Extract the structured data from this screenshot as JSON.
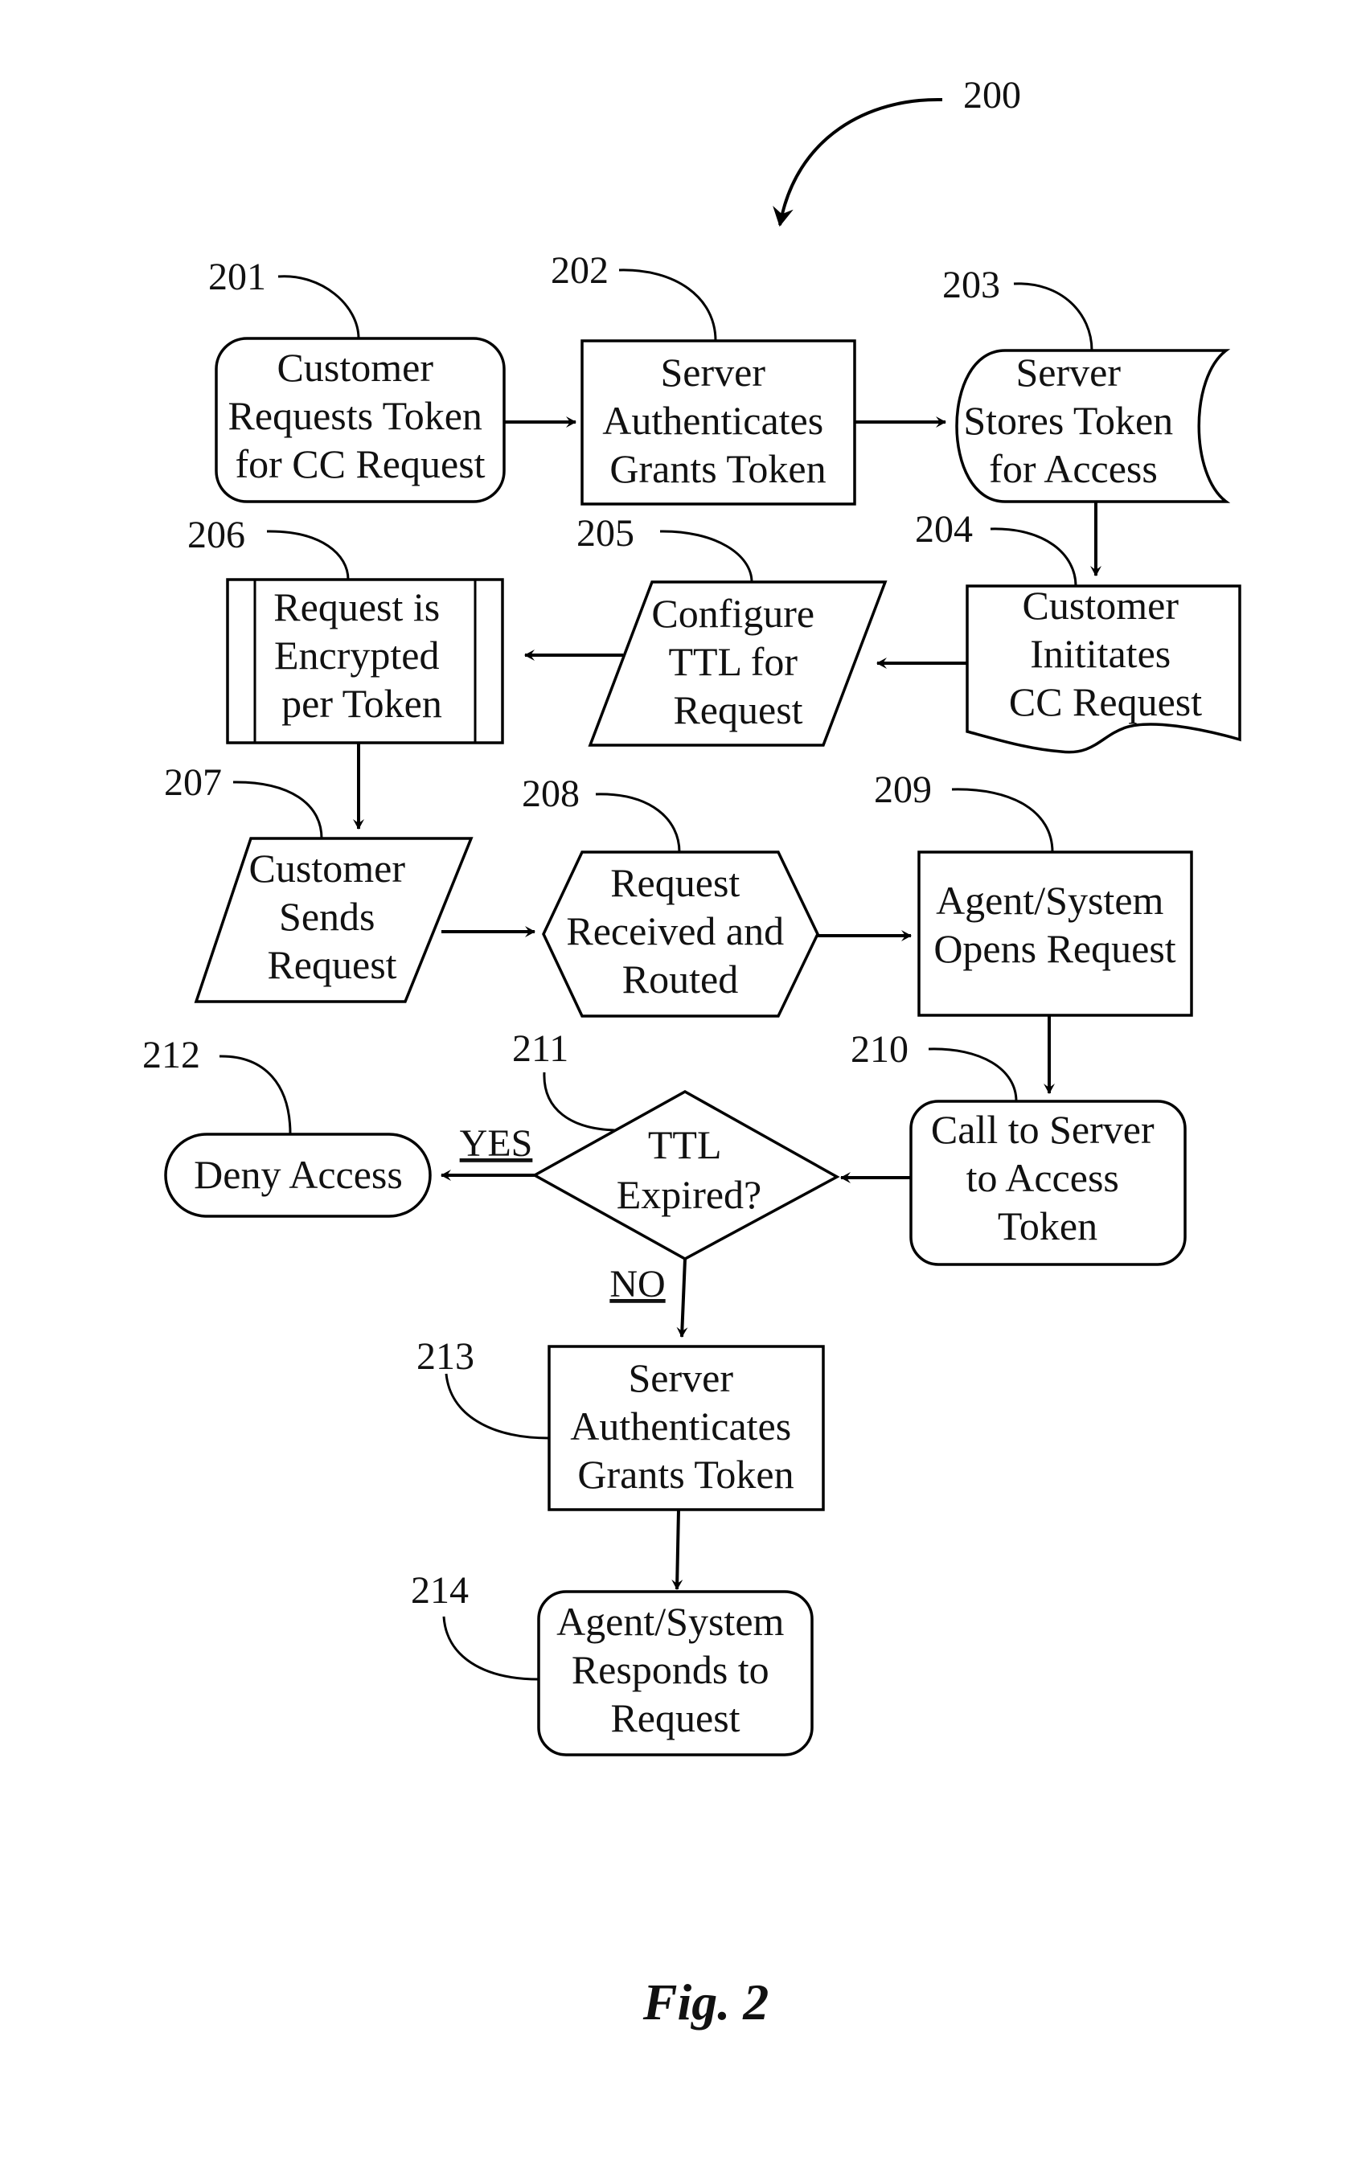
{
  "figure": {
    "reference": "200",
    "caption": "Fig. 2"
  },
  "nodes": {
    "n201": {
      "ref": "201",
      "shape": "rounded-rectangle",
      "lines": [
        "Customer",
        "Requests Token",
        "for CC Request"
      ]
    },
    "n202": {
      "ref": "202",
      "shape": "rectangle",
      "lines": [
        "Server",
        "Authenticates",
        "Grants Token"
      ]
    },
    "n203": {
      "ref": "203",
      "shape": "stored-data",
      "lines": [
        "Server",
        "Stores Token",
        "for Access"
      ]
    },
    "n204": {
      "ref": "204",
      "shape": "document",
      "lines": [
        "Customer",
        "Inititates",
        "CC Request"
      ]
    },
    "n205": {
      "ref": "205",
      "shape": "parallelogram",
      "lines": [
        "Configure",
        "TTL for",
        "Request"
      ]
    },
    "n206": {
      "ref": "206",
      "shape": "predefined-process",
      "lines": [
        "Request is",
        "Encrypted",
        "per Token"
      ]
    },
    "n207": {
      "ref": "207",
      "shape": "parallelogram",
      "lines": [
        "Customer",
        "Sends",
        "Request"
      ]
    },
    "n208": {
      "ref": "208",
      "shape": "hexagon",
      "lines": [
        "Request",
        "Received and",
        "Routed"
      ]
    },
    "n209": {
      "ref": "209",
      "shape": "rectangle",
      "lines": [
        "Agent/System",
        "Opens Request"
      ]
    },
    "n210": {
      "ref": "210",
      "shape": "rounded-rectangle",
      "lines": [
        "Call to Server",
        "to Access",
        "Token"
      ]
    },
    "n211": {
      "ref": "211",
      "shape": "diamond",
      "lines": [
        "TTL",
        "Expired?"
      ]
    },
    "n212": {
      "ref": "212",
      "shape": "terminator",
      "lines": [
        "Deny Access"
      ]
    },
    "n213": {
      "ref": "213",
      "shape": "rectangle",
      "lines": [
        "Server",
        "Authenticates",
        "Grants Token"
      ]
    },
    "n214": {
      "ref": "214",
      "shape": "rounded-rectangle",
      "lines": [
        "Agent/System",
        "Responds to",
        "Request"
      ]
    }
  },
  "edges": [
    {
      "from": "201",
      "to": "202",
      "label": ""
    },
    {
      "from": "202",
      "to": "203",
      "label": ""
    },
    {
      "from": "203",
      "to": "204",
      "label": ""
    },
    {
      "from": "204",
      "to": "205",
      "label": ""
    },
    {
      "from": "205",
      "to": "206",
      "label": ""
    },
    {
      "from": "206",
      "to": "207",
      "label": ""
    },
    {
      "from": "207",
      "to": "208",
      "label": ""
    },
    {
      "from": "208",
      "to": "209",
      "label": ""
    },
    {
      "from": "209",
      "to": "210",
      "label": ""
    },
    {
      "from": "210",
      "to": "211",
      "label": ""
    },
    {
      "from": "211",
      "to": "212",
      "label": "YES"
    },
    {
      "from": "211",
      "to": "213",
      "label": "NO"
    },
    {
      "from": "213",
      "to": "214",
      "label": ""
    }
  ],
  "branch_labels": {
    "yes": "YES",
    "no": "NO"
  }
}
